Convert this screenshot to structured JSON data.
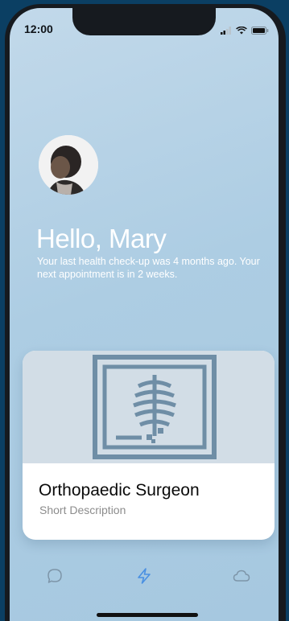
{
  "status_bar": {
    "time": "12:00"
  },
  "greeting": {
    "title": "Hello, Mary",
    "subtitle": "Your last health check-up was 4 months ago.  Your next appointment is in 2 weeks."
  },
  "card": {
    "title": "Orthopaedic Surgeon",
    "description": "Short Description",
    "image_icon": "xray-icon"
  },
  "tabs": [
    {
      "icon": "chat-bubble-icon",
      "active": false
    },
    {
      "icon": "lightning-bolt-icon",
      "active": true
    },
    {
      "icon": "cloud-icon",
      "active": false
    }
  ],
  "colors": {
    "background": "#a6c8e0",
    "accent": "#4a90e2",
    "tab_inactive": "#7d95a8",
    "xray_stroke": "#6f8ea6"
  }
}
